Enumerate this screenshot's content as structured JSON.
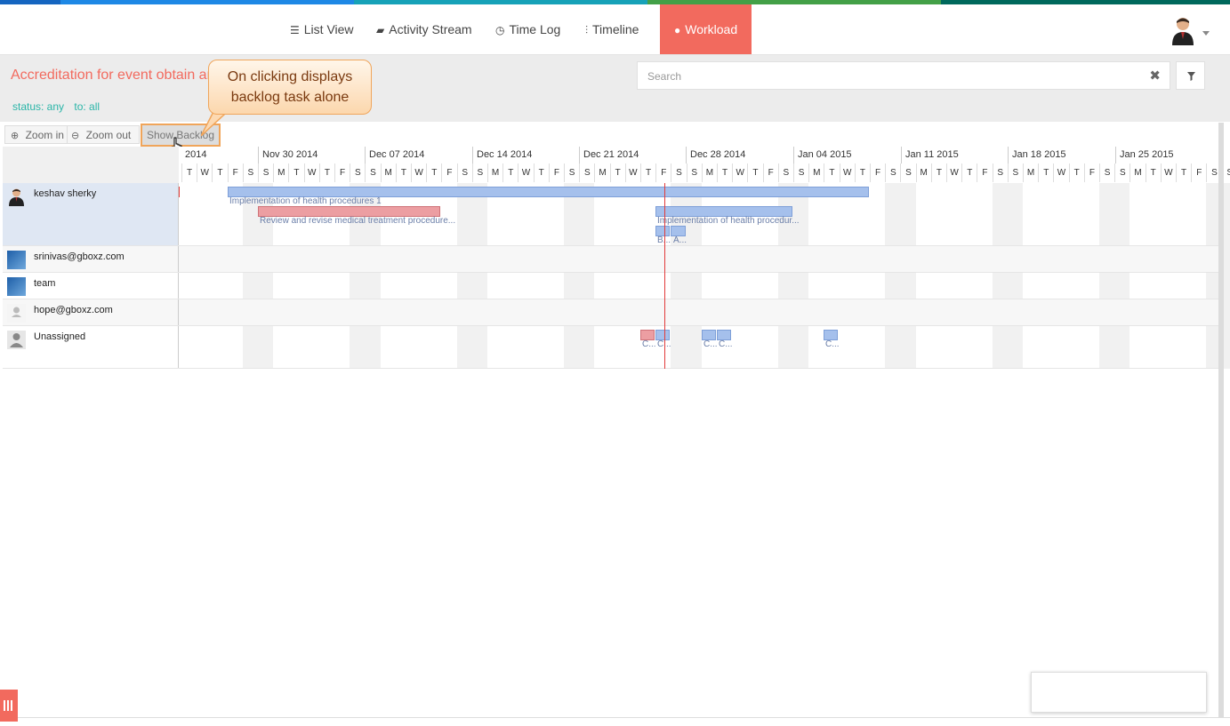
{
  "nav": {
    "items": [
      {
        "label": "List View",
        "icon": "list-icon"
      },
      {
        "label": "Activity Stream",
        "icon": "comment-icon"
      },
      {
        "label": "Time Log",
        "icon": "clock-icon"
      },
      {
        "label": "Timeline",
        "icon": "sliders-icon"
      },
      {
        "label": "Workload",
        "icon": "user-icon",
        "active": true
      }
    ],
    "accent": "#f26a5e"
  },
  "project": {
    "title": "Accreditation for event obtain and",
    "filters": [
      "status: any",
      "to: all"
    ]
  },
  "search": {
    "placeholder": "Search"
  },
  "callout": {
    "line1": "On clicking displays",
    "line2": "backlog task alone"
  },
  "toolbar": {
    "zoom_in": "Zoom in",
    "zoom_out": "Zoom out",
    "show_backlog": "Show Backlog"
  },
  "timeline": {
    "weeks": [
      "2014",
      "Nov 30 2014",
      "Dec 07 2014",
      "Dec 14 2014",
      "Dec 21 2014",
      "Dec 28 2014",
      "Jan 04 2015",
      "Jan 11 2015",
      "Jan 18 2015",
      "Jan 25 2015"
    ],
    "days": [
      "T",
      "W",
      "T",
      "F",
      "S",
      "S",
      "M",
      "T",
      "W",
      "T",
      "F",
      "S",
      "S",
      "M",
      "T",
      "W",
      "T",
      "F",
      "S",
      "S",
      "M",
      "T",
      "W",
      "T",
      "F",
      "S",
      "S",
      "M",
      "T",
      "W",
      "T",
      "F",
      "S",
      "S",
      "M",
      "T",
      "W",
      "T",
      "F",
      "S",
      "S",
      "M",
      "T",
      "W",
      "T",
      "F",
      "S",
      "S",
      "M",
      "T",
      "W",
      "T",
      "F",
      "S",
      "S",
      "M",
      "T",
      "W",
      "T",
      "F",
      "S",
      "S",
      "M",
      "T",
      "W",
      "T",
      "F",
      "S",
      "S"
    ]
  },
  "users": [
    {
      "name": "keshav sherky"
    },
    {
      "name": "srinivas@gboxz.com"
    },
    {
      "name": "team"
    },
    {
      "name": "hope@gboxz.com"
    },
    {
      "name": "Unassigned"
    }
  ],
  "tasks": {
    "t1": "Implementation of health procedures 1",
    "t2": "Review and revise medical treatment procedure...",
    "t3": "Implementation of health procedur...",
    "t4": "B...",
    "t5": "A...",
    "u1": "C...",
    "u2": "C...",
    "u3": "C...",
    "u4": "C...",
    "u5": "C..."
  },
  "colors": {
    "task_blue": "#a5c0ec",
    "task_red": "#ec9ea2",
    "today_line": "#e23b3b"
  }
}
